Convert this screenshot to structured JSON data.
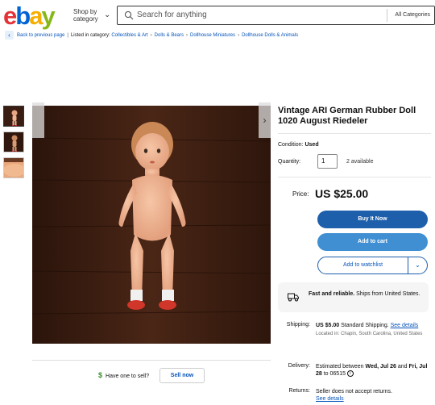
{
  "header": {
    "logo_letters": [
      {
        "char": "e",
        "color": "#e53238"
      },
      {
        "char": "b",
        "color": "#0064d2"
      },
      {
        "char": "a",
        "color": "#f5af02"
      },
      {
        "char": "y",
        "color": "#86b817"
      }
    ],
    "shop_by_line1": "Shop by",
    "shop_by_line2": "category",
    "search_placeholder": "Search for anything",
    "category_select": "All Categories"
  },
  "breadcrumb": {
    "back": "Back to previous page",
    "listed_in": "Listed in category:",
    "items": [
      "Collectibles & Art",
      "Dolls & Bears",
      "Dollhouse Miniatures",
      "Dollhouse Dolls & Animals"
    ]
  },
  "listing": {
    "title": "Vintage ARI German Rubber Doll 1020 August Riedeler",
    "condition_label": "Condition:",
    "condition_value": "Used",
    "quantity_label": "Quantity:",
    "quantity_value": "1",
    "available": "2 available",
    "price_label": "Price:",
    "price": "US $25.00",
    "buy_now": "Buy It Now",
    "add_to_cart": "Add to cart",
    "add_to_watchlist": "Add to watchlist"
  },
  "fast_box": {
    "bold": "Fast and reliable.",
    "text": " Ships from United States."
  },
  "shipping": {
    "label": "Shipping:",
    "cost": "US $5.00",
    "method": " Standard Shipping. ",
    "see_details": "See details",
    "located": "Located in: Chapin, South Carolina, United States"
  },
  "delivery": {
    "label": "Delivery:",
    "prefix": "Estimated between ",
    "date1": "Wed, Jul 26",
    "mid": " and ",
    "date2": "Fri, Jul 28",
    "suffix": " to 06515"
  },
  "returns": {
    "label": "Returns:",
    "text": "Seller does not accept returns.",
    "see_details": "See details"
  },
  "sell": {
    "have_one": "Have one to sell?",
    "sell_now": "Sell now"
  },
  "colors": {
    "brand_blue": "#1d5fab",
    "cart_blue": "#3f8fd2",
    "link_blue": "#0654ba"
  }
}
